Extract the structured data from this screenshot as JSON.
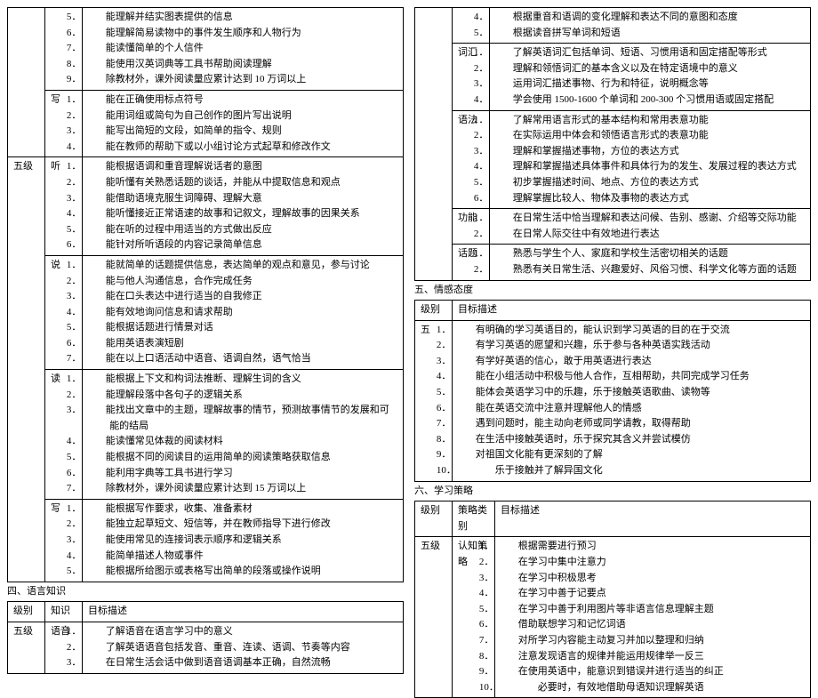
{
  "left": {
    "top_rows": [
      {
        "skill": "",
        "items": [
          "能理解并结实图表提供的信息",
          "能理解简易读物中的事件发生顺序和人物行为",
          "能读懂简单的个人信件",
          "能使用汉英词典等工具书帮助阅读理解",
          "除教材外，课外阅读量应累计达到 10 万词以上"
        ],
        "start": 5
      },
      {
        "skill": "写",
        "items": [
          "能在正确使用标点符号",
          "能用词组或简句为自己创作的图片写出说明",
          "能写出简短的文段，如简单的指令、规则",
          "能在教师的帮助下或以小组讨论方式起草和修改作文"
        ],
        "start": 1
      }
    ],
    "level5": {
      "label": "五级",
      "rows": [
        {
          "skill": "听",
          "items": [
            "能根据语调和重音理解说话者的意图",
            "能听懂有关熟悉话题的谈话，并能从中提取信息和观点",
            "能借助语境克服生词障碍、理解大意",
            "能听懂接近正常语速的故事和记叙文，理解故事的因果关系",
            "能在听的过程中用适当的方式做出反应",
            "能针对所听语段的内容记录简单信息"
          ]
        },
        {
          "skill": "说",
          "items": [
            "能就简单的话题提供信息，表达简单的观点和意见，参与讨论",
            "能与他人沟通信息，合作完成任务",
            "能在口头表达中进行适当的自我修正",
            "能有效地询问信息和请求帮助",
            "能根据话题进行情景对话",
            "能用英语表演短剧",
            "能在以上口语活动中语音、语调自然，语气恰当"
          ]
        },
        {
          "skill": "读",
          "items": [
            "能根据上下文和构词法推断、理解生词的含义",
            "能理解段落中各句子的逻辑关系",
            "能找出文章中的主题，理解故事的情节，预测故事情节的发展和可能的结局",
            "能读懂常见体裁的阅读材料",
            "能根据不同的阅读目的运用简单的阅读策略获取信息",
            "能利用字典等工具书进行学习",
            "除教材外，课外阅读量应累计达到 15 万词以上"
          ]
        },
        {
          "skill": "写",
          "items": [
            "能根据写作要求，收集、准备素材",
            "能独立起草短文、短信等，并在教师指导下进行修改",
            "能使用常见的连接词表示顺序和逻辑关系",
            "能简单描述人物或事件",
            "能根据所给图示或表格写出简单的段落或操作说明"
          ]
        }
      ]
    },
    "section4": {
      "title": "四、语言知识",
      "headers": [
        "级别",
        "知识",
        "目标描述"
      ],
      "level": "五级",
      "rows": [
        {
          "cat": "语音",
          "items": [
            "了解语音在语言学习中的意义",
            "了解英语语音包括发音、重音、连读、语调、节奏等内容",
            "在日常生活会话中做到语音语调基本正确，自然流畅"
          ]
        }
      ]
    }
  },
  "right": {
    "top_rows": [
      {
        "cat": "",
        "items": [
          "根据重音和语调的变化理解和表达不同的意图和态度",
          "根据读音拼写单词和短语"
        ],
        "start": 4
      },
      {
        "cat": "词汇",
        "items": [
          "了解英语词汇包括单词、短语、习惯用语和固定搭配等形式",
          "理解和领悟词汇的基本含义以及在特定语境中的意义",
          "运用词汇描述事物、行为和特征，说明概念等",
          "学会使用 1500-1600 个单词和 200-300 个习惯用语或固定搭配"
        ],
        "start": 1
      },
      {
        "cat": "语法",
        "items": [
          "了解常用语言形式的基本结构和常用表意功能",
          "在实际运用中体会和领悟语言形式的表意功能",
          "理解和掌握描述事物，方位的表达方式",
          "理解和掌握描述具体事件和具体行为的发生、发展过程的表达方式",
          "初步掌握描述时间、地点、方位的表达方式",
          "理解掌握比较人、物体及事物的表达方式"
        ],
        "start": 1
      },
      {
        "cat": "功能",
        "items": [
          "在日常生活中恰当理解和表达问候、告别、感谢、介绍等交际功能",
          "在日常人际交往中有效地进行表达"
        ],
        "start": 1
      },
      {
        "cat": "话题",
        "items": [
          "熟悉与学生个人、家庭和学校生活密切相关的话题",
          "熟悉有关日常生活、兴趣爱好、风俗习惯、科学文化等方面的话题"
        ],
        "start": 1
      }
    ],
    "section5": {
      "title": "五、情感态度",
      "headers": [
        "级别",
        "目标描述"
      ],
      "level": "五",
      "items": [
        "有明确的学习英语目的，能认识到学习英语的目的在于交流",
        "有学习英语的愿望和兴趣，乐于参与各种英语实践活动",
        "有学好英语的信心，敢于用英语进行表达",
        "能在小组活动中积极与他人合作，互相帮助，共同完成学习任务",
        "能体会英语学习中的乐趣，乐于接触英语歌曲、读物等",
        "能在英语交流中注意并理解他人的情感",
        "遇到问题时，能主动向老师或同学请教，取得帮助",
        "在生活中接触英语时，乐于探究其含义并尝试模仿",
        "对祖国文化能有更深刻的了解",
        "乐于接触并了解异国文化"
      ]
    },
    "section6": {
      "title": "六、学习策略",
      "headers": [
        "级别",
        "策略类别",
        "目标描述"
      ],
      "level": "五级",
      "cat": "认知策略",
      "items10": [
        "根据需要进行预习",
        "在学习中集中注意力",
        "在学习中积极思考",
        "在学习中善于记要点",
        "在学习中善于利用图片等非语言信息理解主题",
        "借助联想学习和记忆词语",
        "对所学习内容能主动复习并加以整理和归纳",
        "注意发现语言的规律并能运用规律举一反三",
        "在使用英语中，能意识到错误并进行适当的纠正",
        "必要时，有效地借助母语知识理解英语"
      ]
    }
  }
}
